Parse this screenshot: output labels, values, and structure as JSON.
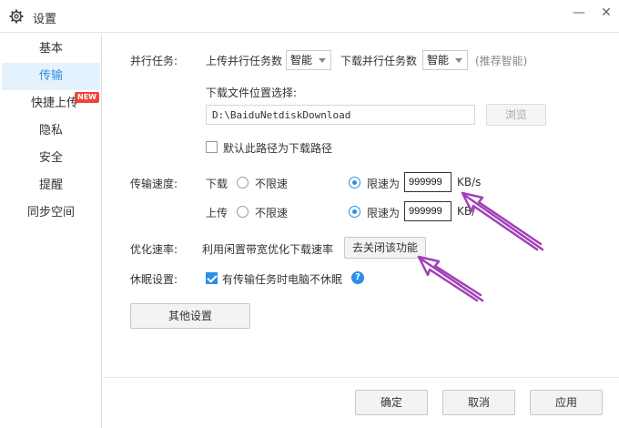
{
  "window": {
    "title": "设置",
    "minimize_symbol": "—",
    "close_symbol": "✕"
  },
  "sidebar": {
    "items": [
      {
        "label": "基本"
      },
      {
        "label": "传输"
      },
      {
        "label": "快捷上传"
      },
      {
        "label": "隐私"
      },
      {
        "label": "安全"
      },
      {
        "label": "提醒"
      },
      {
        "label": "同步空间"
      }
    ],
    "active_index": 1,
    "new_badge": "NEW"
  },
  "parallel": {
    "section_label": "并行任务:",
    "upload_label": "上传并行任务数",
    "upload_value": "智能",
    "download_label": "下载并行任务数",
    "download_value": "智能",
    "hint": "(推荐智能)"
  },
  "download_location": {
    "label": "下载文件位置选择:",
    "path": "D:\\BaiduNetdiskDownload",
    "browse_label": "浏览",
    "default_checkbox_label": "默认此路径为下载路径",
    "default_checked": false
  },
  "speed": {
    "section_label": "传输速度:",
    "download_label": "下载",
    "upload_label": "上传",
    "unlimited_label": "不限速",
    "limit_label": "限速为",
    "download_limit": "999999",
    "upload_limit": "999999",
    "unit_full": "KB/s",
    "unit_partial": "KB/",
    "download_mode": "limit",
    "upload_mode": "limit"
  },
  "optimize": {
    "section_label": "优化速率:",
    "description": "利用闲置带宽优化下载速率",
    "button_label": "去关闭该功能"
  },
  "sleep": {
    "section_label": "休眠设置:",
    "checkbox_label": "有传输任务时电脑不休眠",
    "checked": true,
    "help_symbol": "?"
  },
  "other_settings_label": "其他设置",
  "footer": {
    "ok_label": "确定",
    "cancel_label": "取消",
    "apply_label": "应用"
  },
  "colors": {
    "accent": "#2a8fe6",
    "annotation_arrow": "#a23fb8"
  }
}
